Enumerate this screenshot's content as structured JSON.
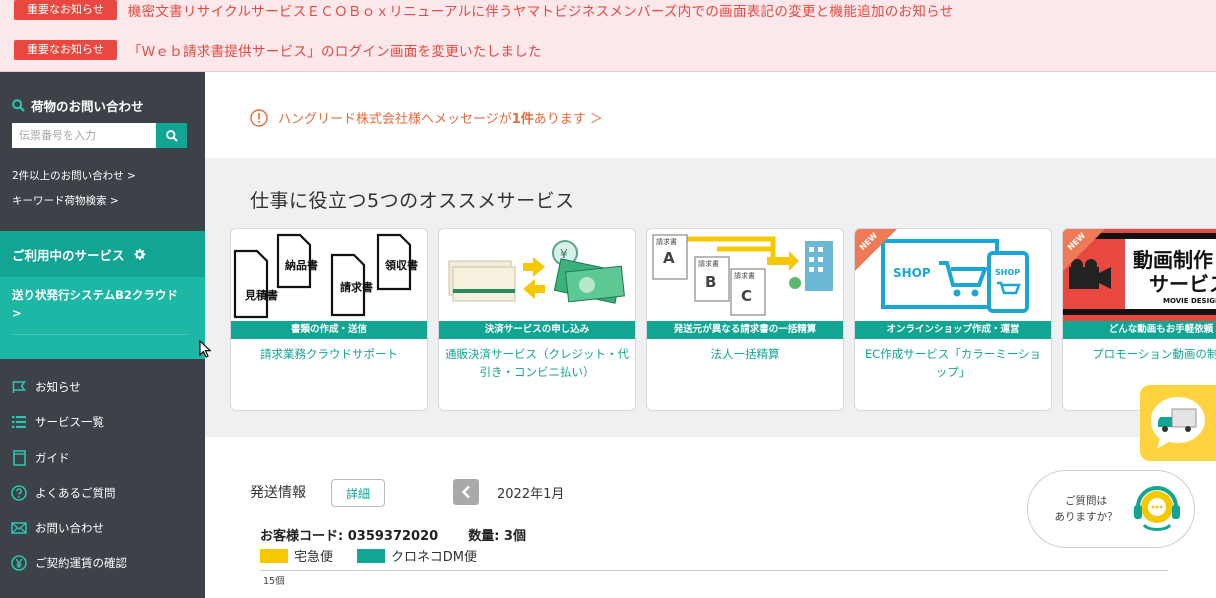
{
  "notices": [
    {
      "badge": "重要なお知らせ",
      "text": "機密文書リサイクルサービスＥＣＯＢｏｘリニューアルに伴うヤマトビジネスメンバーズ内での画面表記の変更と機能追加のお知らせ"
    },
    {
      "badge": "重要なお知らせ",
      "text": "「Ｗｅｂ請求書提供サービス」のログイン画面を変更いたしました"
    }
  ],
  "sidebar": {
    "tracking_title": "荷物のお問い合わせ",
    "tracking_placeholder": "伝票番号を入力",
    "link_multi": "2件以上のお問い合わせ >",
    "link_keyword": "キーワード荷物検索 >",
    "services_title": "ご利用中のサービス",
    "service_item": "送り状発行システムB2クラウド >",
    "menu": [
      "お知らせ",
      "サービス一覧",
      "ガイド",
      "よくあるご質問",
      "お問い合わせ",
      "ご契約運賃の確認"
    ]
  },
  "message": {
    "prefix": "ハングリード株式会社様へメッセージが ",
    "count": "1件",
    "suffix": "あります ＞"
  },
  "recommend": {
    "title": "仕事に役立つ5つのオススメサービス",
    "cards": [
      {
        "band": "書類の作成・送信",
        "title": "請求業務クラウドサポート",
        "art": [
          "見積書",
          "納品書",
          "請求書",
          "領収書"
        ]
      },
      {
        "band": "決済サービスの申し込み",
        "title": "通販決済サービス（クレジット・代引き・コンビニ払い）"
      },
      {
        "band": "発送元が異なる請求書の一括精算",
        "title": "法人一括精算",
        "art": [
          "請求書",
          "請求書",
          "請求書",
          "A",
          "B",
          "C"
        ]
      },
      {
        "band": "オンラインショップ作成・運営",
        "title": "EC作成サービス「カラーミーショップ」",
        "new": "NEW",
        "art": [
          "SHOP",
          "SHOP"
        ]
      },
      {
        "band": "どんな動画もお手軽依頼",
        "title": "プロモーション動画の制作",
        "new": "NEW",
        "art": [
          "動画制作",
          "サービス",
          "MOVIE DESIGN"
        ]
      }
    ]
  },
  "shipping": {
    "title": "発送情報",
    "detail_button": "詳細",
    "month": "2022年1月",
    "customer_code": "お客様コード: 0359372020",
    "quantity": "数量: 3個",
    "legend": [
      {
        "name": "宅急便",
        "color": "#f5c800"
      },
      {
        "name": "クロネコDM便",
        "color": "#12a594"
      }
    ],
    "axis_tick": "15個"
  },
  "help": {
    "line1": "ご質問は",
    "line2": "ありますか？"
  },
  "colors": {
    "accent": "#12a594",
    "alert": "#e8483f",
    "sidebar": "#3d4148"
  }
}
